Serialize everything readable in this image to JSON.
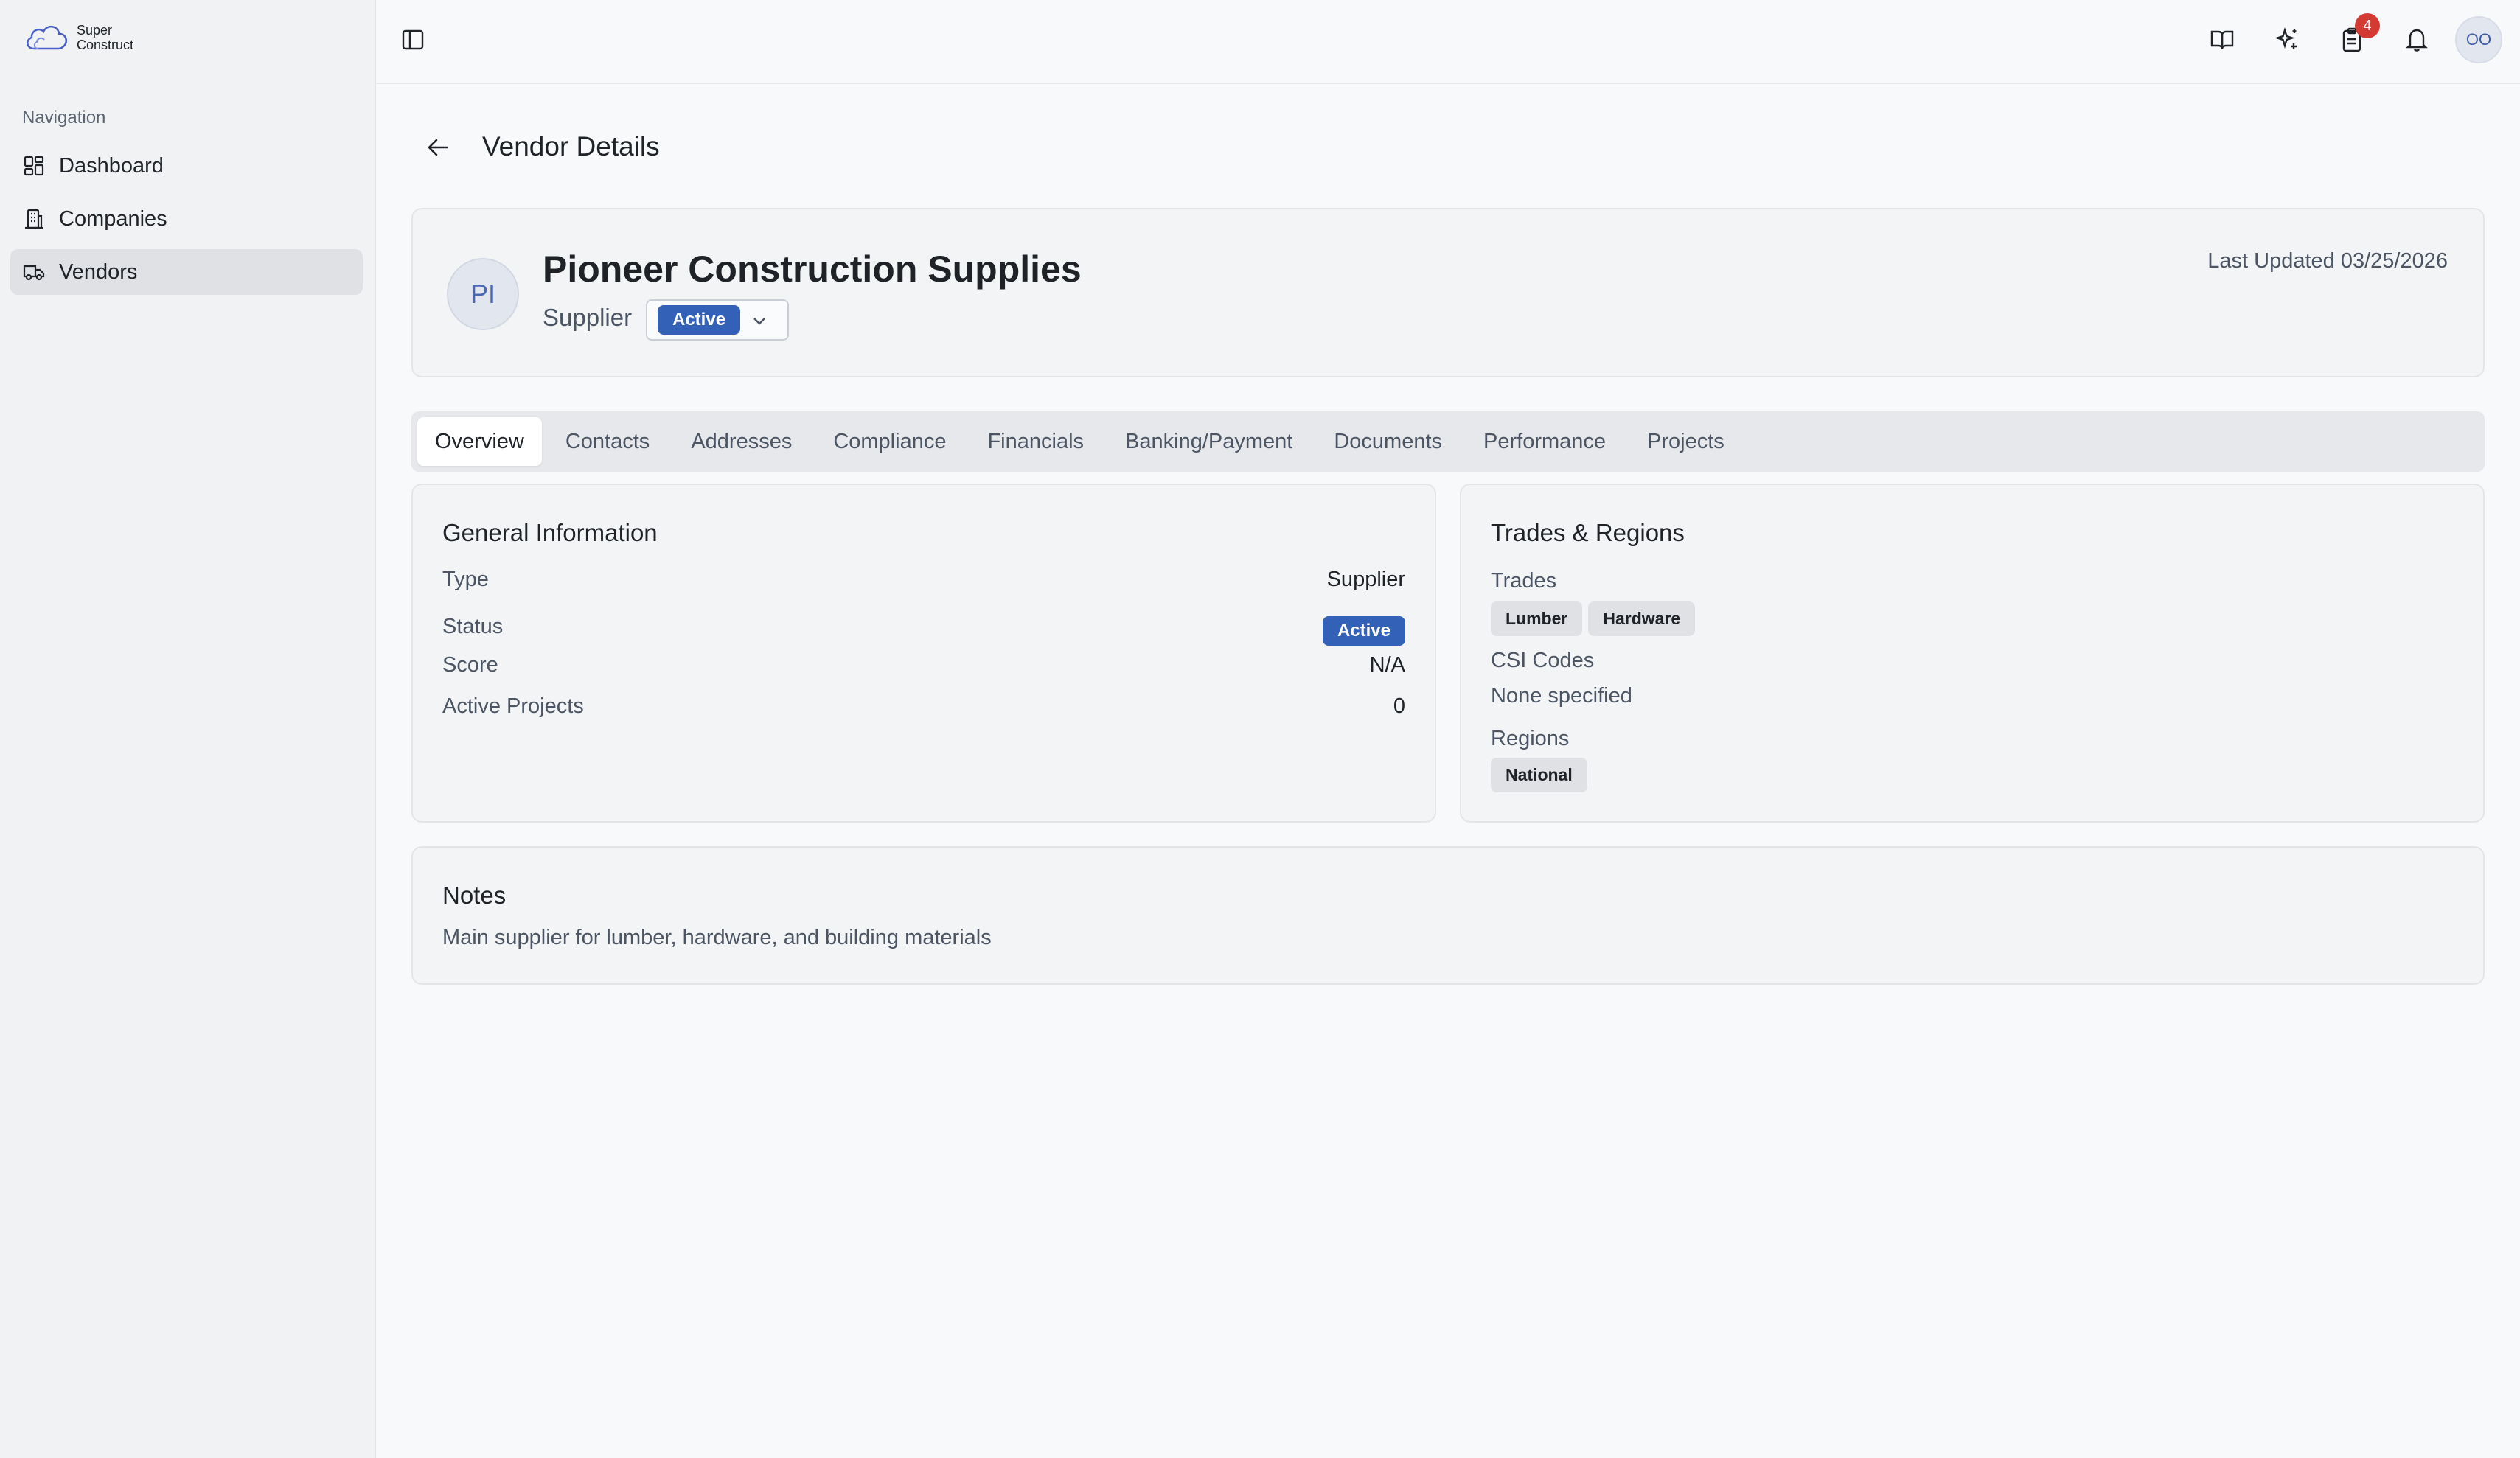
{
  "app": {
    "logo_line1": "Super",
    "logo_line2": "Construct"
  },
  "sidebar": {
    "heading": "Navigation",
    "items": [
      {
        "label": "Dashboard",
        "icon": "dashboard-icon"
      },
      {
        "label": "Companies",
        "icon": "building-icon"
      },
      {
        "label": "Vendors",
        "icon": "truck-icon",
        "active": true
      }
    ]
  },
  "topbar": {
    "notification_count": "4",
    "avatar_initials": "OO"
  },
  "page": {
    "title": "Vendor Details"
  },
  "vendor": {
    "initials": "PI",
    "name": "Pioneer Construction Supplies",
    "type": "Supplier",
    "status": "Active",
    "last_updated": "Last Updated 03/25/2026"
  },
  "tabs": [
    "Overview",
    "Contacts",
    "Addresses",
    "Compliance",
    "Financials",
    "Banking/Payment",
    "Documents",
    "Performance",
    "Projects"
  ],
  "general": {
    "title": "General Information",
    "rows": [
      {
        "label": "Type",
        "value": "Supplier"
      },
      {
        "label": "Status",
        "value": "Active"
      },
      {
        "label": "Score",
        "value": "N/A"
      },
      {
        "label": "Active Projects",
        "value": "0"
      }
    ]
  },
  "trades": {
    "title": "Trades & Regions",
    "trades_label": "Trades",
    "trades": [
      "Lumber",
      "Hardware"
    ],
    "csi_label": "CSI Codes",
    "csi_value": "None specified",
    "regions_label": "Regions",
    "regions": [
      "National"
    ]
  },
  "notes": {
    "title": "Notes",
    "text": "Main supplier for lumber, hardware, and building materials"
  },
  "colors": {
    "accent": "#3361b8",
    "badge": "#d43a34"
  }
}
